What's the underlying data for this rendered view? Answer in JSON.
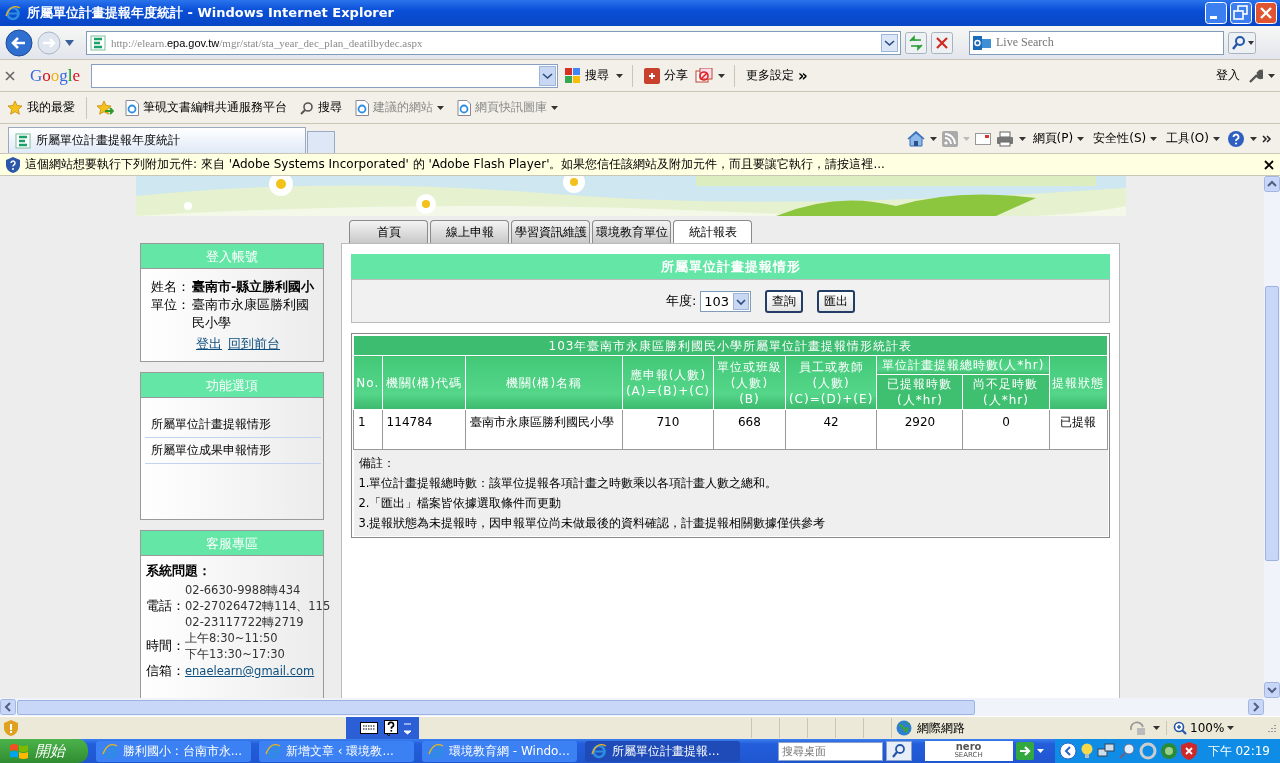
{
  "window": {
    "title": "所屬單位計畫提報年度統計 - Windows Internet Explorer"
  },
  "address_bar": {
    "url_prefix": "http://elearn.",
    "url_domain": "epa.gov.tw",
    "url_path": "/mgr/stat/sta_year_dec_plan_deatilbydec.aspx"
  },
  "search_box": {
    "placeholder": "Live Search"
  },
  "google_toolbar": {
    "logo": "Google",
    "search_button": "搜尋",
    "share_button": "分享",
    "more_settings": "更多設定",
    "more_mark": "»",
    "sign_in": "登入"
  },
  "favorites_bar": {
    "favorites": "我的最愛",
    "links": [
      {
        "label": "筆硯文書編輯共通服務平台",
        "kind": "page",
        "dropdown": false,
        "disabled": false
      },
      {
        "label": "搜尋",
        "kind": "search",
        "dropdown": false,
        "disabled": false
      },
      {
        "label": "建議的網站",
        "kind": "page",
        "dropdown": true,
        "disabled": true
      },
      {
        "label": "網頁快訊圖庫",
        "kind": "page",
        "dropdown": true,
        "disabled": true
      }
    ]
  },
  "browser_tabs": [
    {
      "title": "所屬單位計畫提報年度統計",
      "selected": true
    }
  ],
  "command_bar": {
    "menus": [
      "網頁(P)",
      "安全性(S)",
      "工具(O)"
    ]
  },
  "info_bar": {
    "message": "這個網站想要執行下列附加元件: 來自 'Adobe Systems Incorporated' 的 'Adobe Flash Player'。如果您信任該網站及附加元件，而且要讓它執行，請按這裡..."
  },
  "page": {
    "nav_tabs": [
      {
        "label": "首頁",
        "selected": false
      },
      {
        "label": "線上申報",
        "selected": false
      },
      {
        "label": "學習資訊維護",
        "selected": false
      },
      {
        "label": "環境教育單位",
        "selected": false
      },
      {
        "label": "統計報表",
        "selected": true
      }
    ],
    "login_panel": {
      "title": "登入帳號",
      "fields": [
        {
          "label": "姓名：",
          "value": "臺南市-縣立勝利國小",
          "bold": true
        },
        {
          "label": "單位：",
          "value": "臺南市永康區勝利國民小學",
          "bold": false
        }
      ],
      "links": [
        "登出",
        "回到前台"
      ]
    },
    "function_panel": {
      "title": "功能選項",
      "items": [
        "所屬單位計畫提報情形",
        "所屬單位成果申報情形"
      ]
    },
    "service_panel": {
      "title": "客服專區",
      "heading": "系統問題：",
      "rows": [
        {
          "label": "電話：",
          "kind": "text",
          "lines": [
            "02-6630-9988轉434",
            "02-27026472轉114、115",
            "02-23117722轉2719"
          ]
        },
        {
          "label": "時間：",
          "kind": "text",
          "lines": [
            "上午8:30~11:50",
            "下午13:30~17:30"
          ]
        },
        {
          "label": "信箱：",
          "kind": "link",
          "lines": [
            "enaelearn@gmail.com"
          ]
        }
      ]
    },
    "report": {
      "title": "所屬單位計畫提報情形",
      "year_label": "年度:",
      "year": "103",
      "buttons": [
        "查詢",
        "匯出"
      ],
      "table": {
        "caption": "103年臺南市永康區勝利國民小學所屬單位計畫提報情形統計表",
        "columns": [
          {
            "lines": [
              "No."
            ]
          },
          {
            "lines": [
              "機關(構)代碼"
            ]
          },
          {
            "lines": [
              "機關(構)名稱"
            ]
          },
          {
            "lines": [
              "應申報(人數)",
              "(A)=(B)+(C)"
            ]
          },
          {
            "lines": [
              "單位或班級",
              "(人數)",
              "(B)"
            ]
          },
          {
            "lines": [
              "員工或教師",
              "(人數)",
              "(C)=(D)+(E)"
            ]
          },
          {
            "group": "單位計畫提報總時數(人*hr)",
            "colspan": 2,
            "children": [
              {
                "lines": [
                  "已提報時數",
                  "(人*hr)"
                ]
              },
              {
                "lines": [
                  "尚不足時數",
                  "(人*hr)"
                ]
              }
            ]
          },
          {
            "lines": [
              "提報狀態"
            ]
          }
        ],
        "rows": [
          [
            "1",
            "114784",
            "臺南市永康區勝利國民小學",
            "710",
            "668",
            "42",
            "2920",
            "0",
            "已提報"
          ]
        ],
        "notes_title": "備註：",
        "notes": [
          "1.單位計畫提報總時數：該單位提報各項計畫之時數乘以各項計畫人數之總和。",
          "2.「匯出」檔案皆依據選取條件而更動",
          "3.提報狀態為未提報時，因申報單位尚未做最後的資料確認，計畫提報相關數據僅供參考"
        ]
      }
    }
  },
  "status_bar": {
    "zone": "網際網路",
    "zoom": "100%"
  },
  "taskbar": {
    "start": "開始",
    "tasks": [
      {
        "title": "勝利國小 : 台南市永...",
        "selected": false
      },
      {
        "title": "新增文章 ‹ 環境教...",
        "selected": false
      },
      {
        "title": "環境教育網 - Windo...",
        "selected": false
      },
      {
        "title": "所屬單位計畫提報...",
        "selected": true
      }
    ],
    "search_placeholder": "搜尋桌面",
    "nero_logo": "nero",
    "nero_sub": "SEARCH",
    "clock": "下午 02:19"
  }
}
